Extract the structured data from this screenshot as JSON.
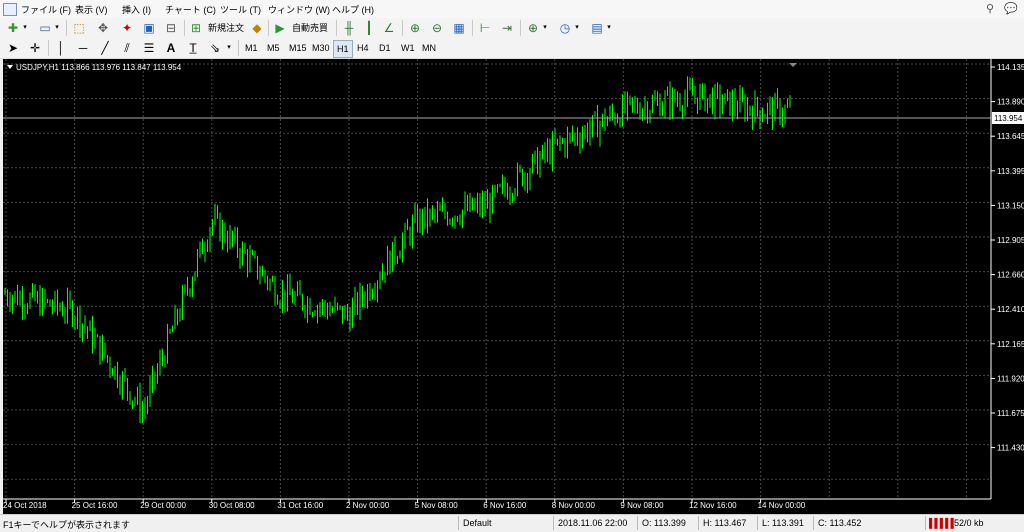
{
  "menu": [
    "ファイル (F)",
    "表示 (V)",
    "挿入 (I)",
    "チャート (C)",
    "ツール (T)",
    "ウィンドウ (W)",
    "ヘルプ (H)"
  ],
  "toolbar": {
    "new_order": "新規注文",
    "auto_trade": "自動売買"
  },
  "timeframes": [
    "M1",
    "M5",
    "M15",
    "M30",
    "H1",
    "H4",
    "D1",
    "W1",
    "MN"
  ],
  "chart": {
    "header": "USDJPY,H1  113.866 113.976 113.847 113.954",
    "price_labels": [
      "114.135",
      "113.890",
      "113.645",
      "113.395",
      "113.150",
      "112.905",
      "112.660",
      "112.410",
      "112.165",
      "111.920",
      "111.675",
      "111.430"
    ],
    "current_price": "113.954",
    "time_labels": [
      "24 Oct 2018",
      "25 Oct 16:00",
      "29 Oct 00:00",
      "30 Oct 08:00",
      "31 Oct 16:00",
      "2 Nov 00:00",
      "5 Nov 08:00",
      "6 Nov 16:00",
      "8 Nov 00:00",
      "9 Nov 08:00",
      "12 Nov 16:00",
      "14 Nov 00:00"
    ],
    "colors": {
      "bg": "#000000",
      "candle": "#00ff00",
      "grid": "#4a4a4a",
      "text": "#ffffff"
    }
  },
  "chart_data": {
    "type": "line",
    "title": "USDJPY,H1",
    "x": [
      "24 Oct 2018",
      "25 Oct 16:00",
      "29 Oct 00:00",
      "30 Oct 08:00",
      "31 Oct 16:00",
      "2 Nov 00:00",
      "5 Nov 08:00",
      "6 Nov 16:00",
      "8 Nov 00:00",
      "9 Nov 08:00",
      "12 Nov 16:00",
      "14 Nov 00:00"
    ],
    "y": [
      112.7,
      112.58,
      111.9,
      113.2,
      112.7,
      112.55,
      113.2,
      113.3,
      113.7,
      113.95,
      114.05,
      113.95
    ],
    "ylim": [
      111.3,
      114.3
    ],
    "grid": true
  },
  "status": {
    "help": "F1キーでヘルプが表示されます",
    "profile": "Default",
    "datetime": "2018.11.06 22:00",
    "open": "O: 113.399",
    "high": "H: 113.467",
    "low": "L: 113.391",
    "close": "C: 113.452",
    "traffic": "52/0 kb"
  }
}
